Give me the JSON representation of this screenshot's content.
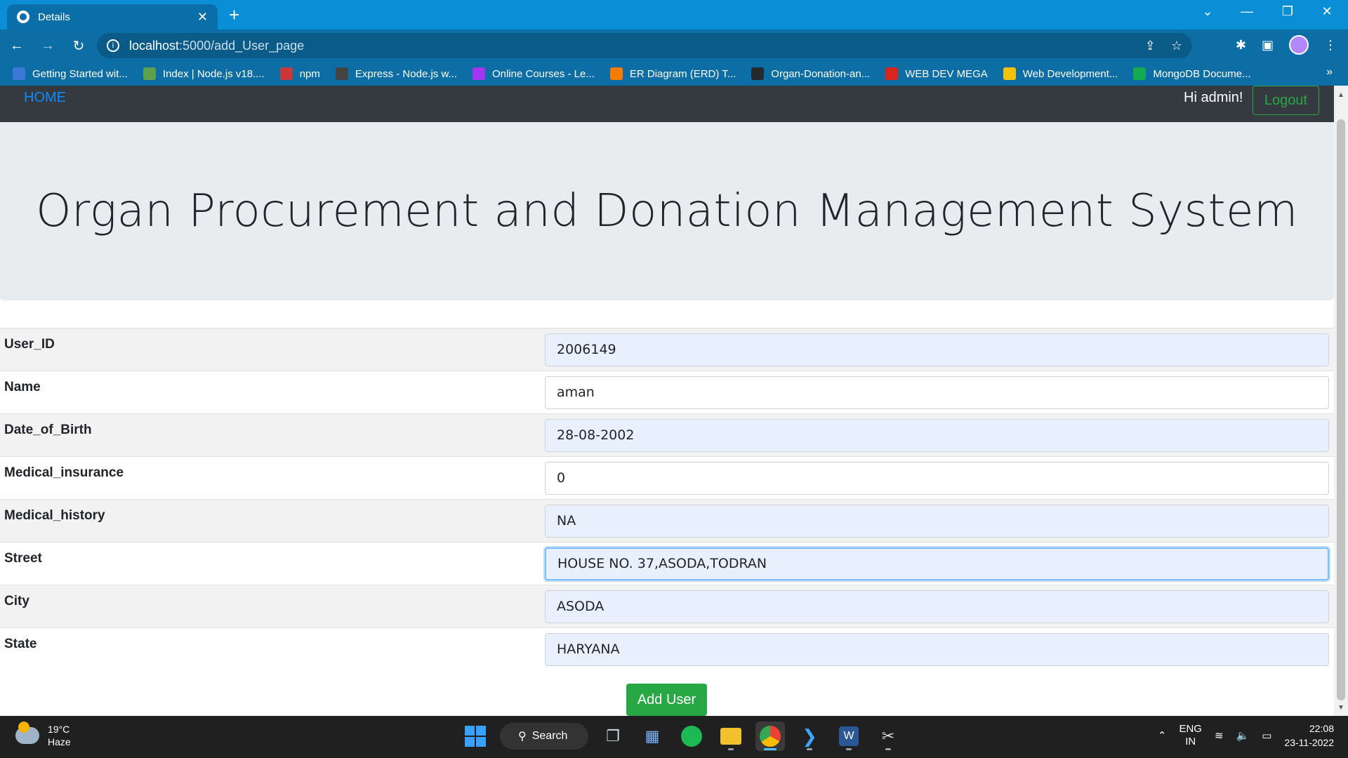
{
  "browser": {
    "tab_title": "Details",
    "tab_close": "✕",
    "new_tab": "+",
    "url_host": "localhost",
    "url_path": ":5000/add_User_page",
    "bookmarks": [
      {
        "label": "Getting Started wit...",
        "color": "#3c78d8"
      },
      {
        "label": "Index | Node.js v18....",
        "color": "#5fa04e"
      },
      {
        "label": "npm",
        "color": "#cb3837"
      },
      {
        "label": "Express - Node.js w...",
        "color": "#444444"
      },
      {
        "label": "Online Courses - Le...",
        "color": "#a435f0"
      },
      {
        "label": "ER Diagram (ERD) T...",
        "color": "#f57c00"
      },
      {
        "label": "Organ-Donation-an...",
        "color": "#24292e"
      },
      {
        "label": "WEB DEV MEGA",
        "color": "#d9251d"
      },
      {
        "label": "Web Development...",
        "color": "#f4c20d"
      },
      {
        "label": "MongoDB Docume...",
        "color": "#13aa52"
      }
    ],
    "bookmarks_more": "»"
  },
  "navbar": {
    "home": "HOME",
    "greeting": "Hi admin!",
    "logout": "Logout"
  },
  "header": {
    "title": "Organ Procurement and Donation Management System"
  },
  "form": {
    "fields": [
      {
        "label": "User_ID",
        "value": "2006149"
      },
      {
        "label": "Name",
        "value": "aman"
      },
      {
        "label": "Date_of_Birth",
        "value": "28-08-2002"
      },
      {
        "label": "Medical_insurance",
        "value": "0"
      },
      {
        "label": "Medical_history",
        "value": "NA"
      },
      {
        "label": "Street",
        "value": "HOUSE NO. 37,ASODA,TODRAN"
      },
      {
        "label": "City",
        "value": "ASODA"
      },
      {
        "label": "State",
        "value": "HARYANA"
      }
    ],
    "submit_label": "Add User"
  },
  "taskbar": {
    "weather_temp": "19°C",
    "weather_desc": "Haze",
    "search_label": "Search",
    "lang_top": "ENG",
    "lang_bottom": "IN",
    "time": "22:08",
    "date": "23-11-2022"
  }
}
